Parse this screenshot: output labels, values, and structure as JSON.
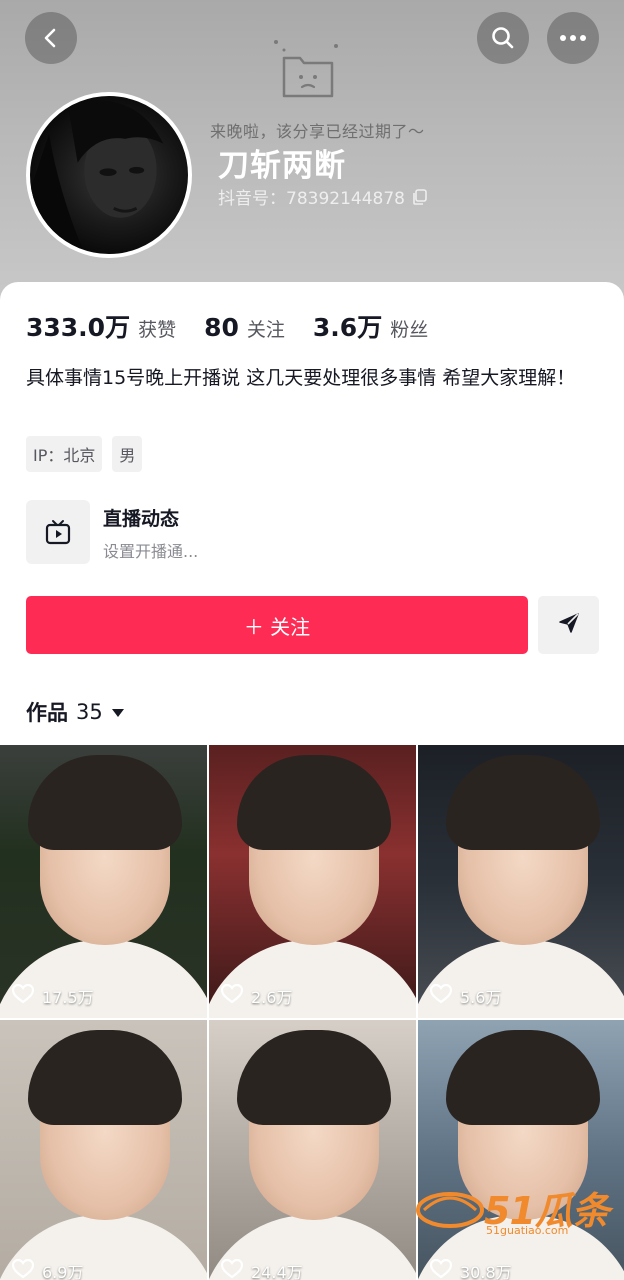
{
  "header": {
    "expired_text": "来晚啦，该分享已经过期了～",
    "nickname": "刀斩两断",
    "douyin_id": "抖音号：78392144878",
    "icons": {
      "back": "back-icon",
      "search": "search-icon",
      "more": "more-icon",
      "expired": "expired-folder-icon",
      "copy": "copy-icon"
    }
  },
  "stats": [
    {
      "value": "333.0万",
      "label": "获赞"
    },
    {
      "value": "80",
      "label": "关注"
    },
    {
      "value": "3.6万",
      "label": "粉丝"
    }
  ],
  "bio": "具体事情15号晚上开播说 这几天要处理很多事情 希望大家理解！",
  "tags": [
    "IP：北京",
    "男"
  ],
  "live": {
    "title": "直播动态",
    "subtitle": "设置开播通..."
  },
  "follow_button": "＋ 关注",
  "works": {
    "label": "作品",
    "count": "35"
  },
  "videos": [
    {
      "likes": "17.5万"
    },
    {
      "likes": "2.6万"
    },
    {
      "likes": "5.6万"
    },
    {
      "likes": "6.9万"
    },
    {
      "likes": "24.4万"
    },
    {
      "likes": "30.8万"
    }
  ],
  "watermark": {
    "brand": "51瓜条",
    "url": "51guatiao.com"
  },
  "colors": {
    "accent": "#fe2c55",
    "text_primary": "#161823",
    "text_secondary": "#57585f",
    "tag_bg": "#f1f1f2"
  }
}
